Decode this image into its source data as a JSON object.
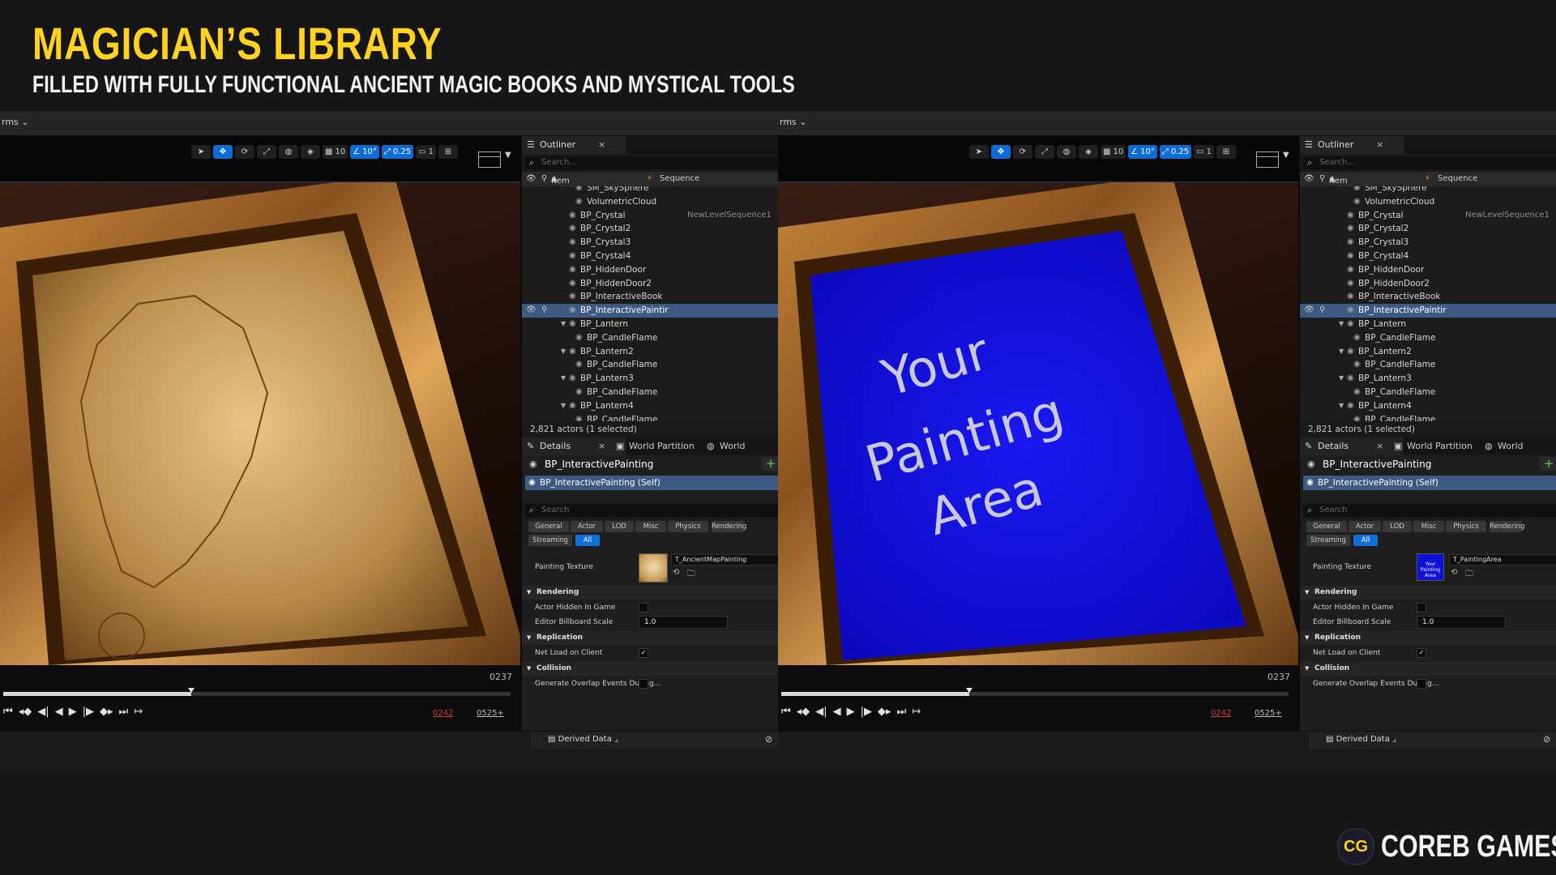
{
  "header": {
    "title": "MAGICIAN’S LIBRARY",
    "subtitle": "FILLED WITH FULLY FUNCTIONAL ANCIENT MAGIC BOOKS AND MYSTICAL TOOLS"
  },
  "logo": {
    "badge": "CG",
    "text": "COREB GAMES"
  },
  "colors": {
    "accent": "#ffd21f",
    "selection": "#3d5a82",
    "blue_active": "#0f70d8",
    "painting_blue": "#1010d8"
  },
  "editor": {
    "transforms_label": "rms",
    "viewport_toolbar": {
      "grid_snap": "10",
      "rotation_snap": "10°",
      "scale_snap": "0.25",
      "camera_speed": "1"
    },
    "timeline": {
      "frame_display": "0237",
      "current_frame": "0242",
      "end_frame": "0525+",
      "playhead_fraction": 0.37
    },
    "outliner": {
      "tab_label": "Outliner",
      "search_placeholder": "Search...",
      "col_item_label": "Item Label",
      "col_sequence": "Sequence",
      "rows": [
        {
          "label": "SM_SkySphere",
          "indent": 3,
          "arrow": false
        },
        {
          "label": "VolumetricCloud",
          "indent": 3,
          "arrow": false
        },
        {
          "label": "BP_Crystal",
          "indent": 2,
          "arrow": false,
          "seq": "NewLevelSequence1"
        },
        {
          "label": "BP_Crystal2",
          "indent": 2,
          "arrow": false
        },
        {
          "label": "BP_Crystal3",
          "indent": 2,
          "arrow": false
        },
        {
          "label": "BP_Crystal4",
          "indent": 2,
          "arrow": false
        },
        {
          "label": "BP_HiddenDoor",
          "indent": 2,
          "arrow": false
        },
        {
          "label": "BP_HiddenDoor2",
          "indent": 2,
          "arrow": false
        },
        {
          "label": "BP_InteractiveBook",
          "indent": 2,
          "arrow": false
        },
        {
          "label": "BP_InteractivePaintir",
          "indent": 2,
          "arrow": false,
          "selected": true
        },
        {
          "label": "BP_Lantern",
          "indent": 2,
          "arrow": true
        },
        {
          "label": "BP_CandleFlame",
          "indent": 3,
          "arrow": false
        },
        {
          "label": "BP_Lantern2",
          "indent": 2,
          "arrow": true
        },
        {
          "label": "BP_CandleFlame",
          "indent": 3,
          "arrow": false
        },
        {
          "label": "BP_Lantern3",
          "indent": 2,
          "arrow": true
        },
        {
          "label": "BP_CandleFlame",
          "indent": 3,
          "arrow": false
        },
        {
          "label": "BP_Lantern4",
          "indent": 2,
          "arrow": true
        },
        {
          "label": "BP_CandleFlame",
          "indent": 3,
          "arrow": false
        }
      ],
      "status": "2,821 actors (1 selected)"
    },
    "details": {
      "tab_details": "Details",
      "tab_world_partition": "World Partition",
      "tab_world": "World",
      "actor_name": "BP_InteractivePainting",
      "self_row": "BP_InteractivePainting (Self)",
      "search_placeholder": "Search",
      "categories": [
        "General",
        "Actor",
        "LOD",
        "Misc",
        "Physics",
        "Rendering"
      ],
      "categories_row2": [
        "Streaming",
        "All"
      ],
      "painting_texture_label": "Painting Texture",
      "section_rendering": "Rendering",
      "actor_hidden_label": "Actor Hidden In Game",
      "billboard_label": "Editor Billboard Scale",
      "billboard_value": "1.0",
      "section_replication": "Replication",
      "net_load_label": "Net Load on Client",
      "section_collision": "Collision",
      "overlap_label": "Generate Overlap Events During..."
    },
    "statusbar": {
      "derived_data": "Derived Data"
    }
  },
  "left_panel": {
    "texture_name": "T_AncientMapPainting"
  },
  "right_panel": {
    "texture_name": "T_PaintingArea",
    "thumb_text": "Your Painting Area",
    "painting_text": [
      "Your",
      "Painting",
      "Area"
    ]
  }
}
